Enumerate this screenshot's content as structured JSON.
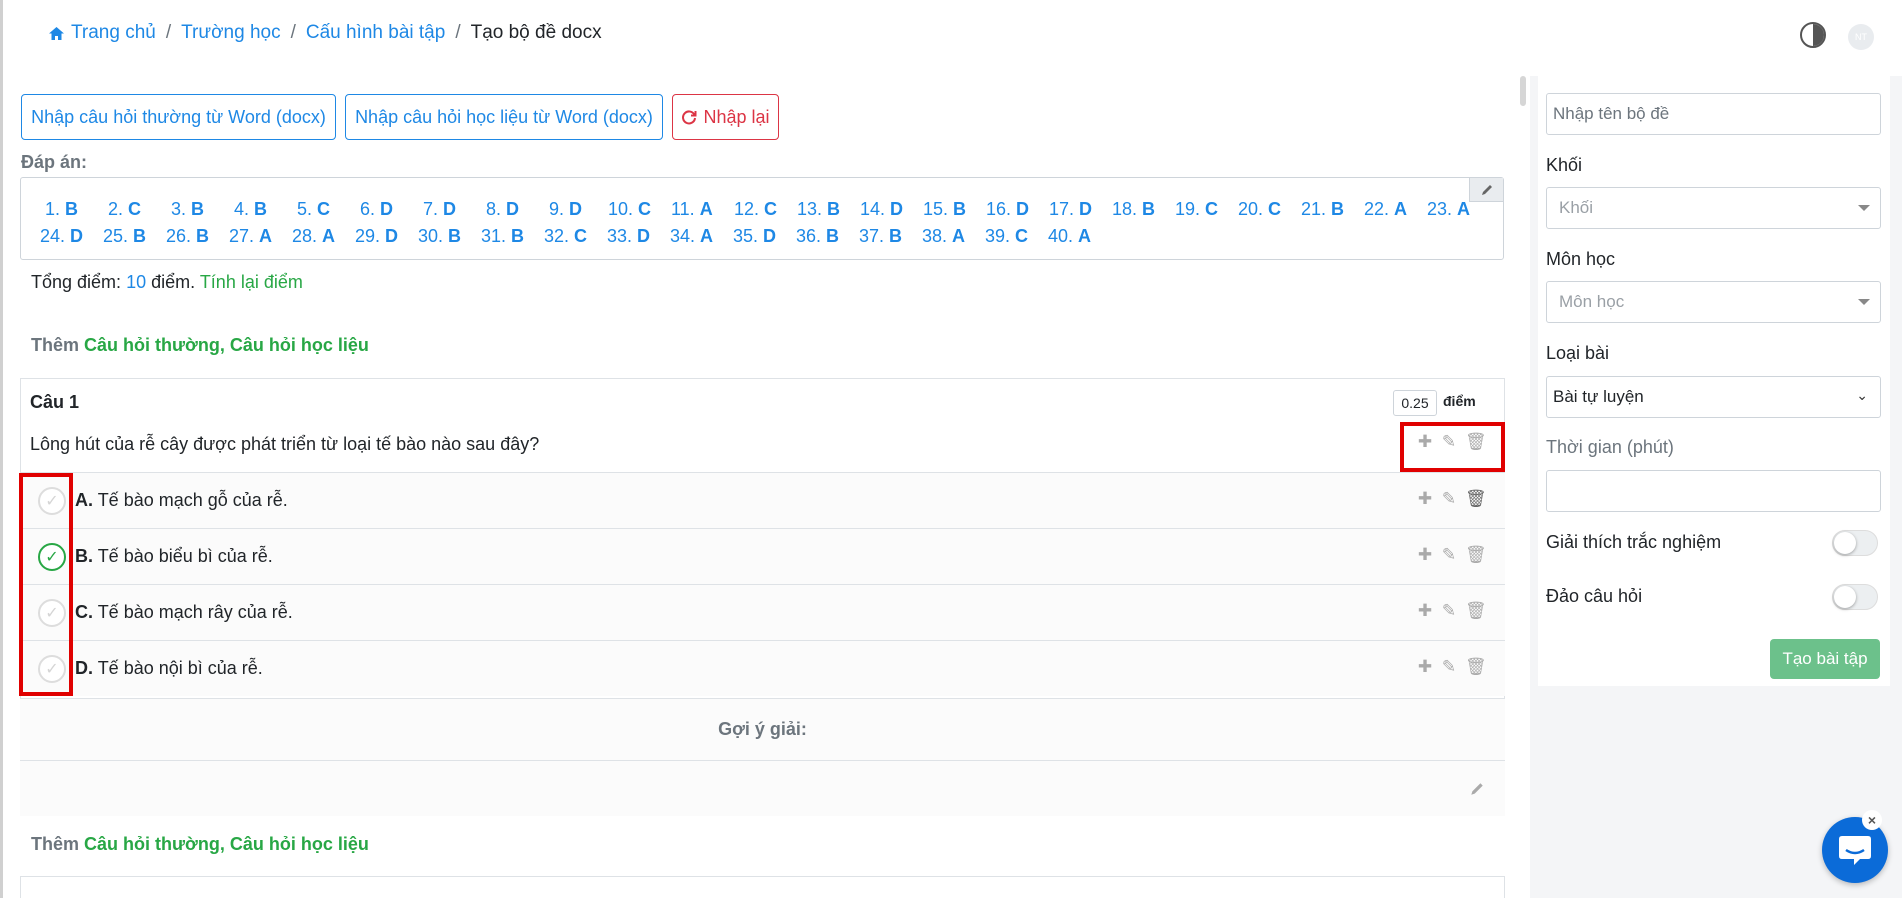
{
  "breadcrumb": {
    "home": "Trang chủ",
    "school": "Trường học",
    "config": "Cấu hình bài tập",
    "current": "Tạo bộ đề docx"
  },
  "header": {
    "avatar_initials": "NT"
  },
  "toolbar": {
    "import_normal": "Nhập câu hỏi thường từ Word (docx)",
    "import_material": "Nhập câu hỏi học liệu từ Word (docx)",
    "reset": "Nhập lại"
  },
  "answers": {
    "label": "Đáp án:",
    "items": [
      {
        "n": "1.",
        "a": "B"
      },
      {
        "n": "2.",
        "a": "C"
      },
      {
        "n": "3.",
        "a": "B"
      },
      {
        "n": "4.",
        "a": "B"
      },
      {
        "n": "5.",
        "a": "C"
      },
      {
        "n": "6.",
        "a": "D"
      },
      {
        "n": "7.",
        "a": "D"
      },
      {
        "n": "8.",
        "a": "D"
      },
      {
        "n": "9.",
        "a": "D"
      },
      {
        "n": "10.",
        "a": "C"
      },
      {
        "n": "11.",
        "a": "A"
      },
      {
        "n": "12.",
        "a": "C"
      },
      {
        "n": "13.",
        "a": "B"
      },
      {
        "n": "14.",
        "a": "D"
      },
      {
        "n": "15.",
        "a": "B"
      },
      {
        "n": "16.",
        "a": "D"
      },
      {
        "n": "17.",
        "a": "D"
      },
      {
        "n": "18.",
        "a": "B"
      },
      {
        "n": "19.",
        "a": "C"
      },
      {
        "n": "20.",
        "a": "C"
      },
      {
        "n": "21.",
        "a": "B"
      },
      {
        "n": "22.",
        "a": "A"
      },
      {
        "n": "23.",
        "a": "A"
      },
      {
        "n": "24.",
        "a": "D"
      },
      {
        "n": "25.",
        "a": "B"
      },
      {
        "n": "26.",
        "a": "B"
      },
      {
        "n": "27.",
        "a": "A"
      },
      {
        "n": "28.",
        "a": "A"
      },
      {
        "n": "29.",
        "a": "D"
      },
      {
        "n": "30.",
        "a": "B"
      },
      {
        "n": "31.",
        "a": "B"
      },
      {
        "n": "32.",
        "a": "C"
      },
      {
        "n": "33.",
        "a": "D"
      },
      {
        "n": "34.",
        "a": "A"
      },
      {
        "n": "35.",
        "a": "D"
      },
      {
        "n": "36.",
        "a": "B"
      },
      {
        "n": "37.",
        "a": "B"
      },
      {
        "n": "38.",
        "a": "A"
      },
      {
        "n": "39.",
        "a": "C"
      },
      {
        "n": "40.",
        "a": "A"
      }
    ]
  },
  "total": {
    "prefix": "Tổng điểm:",
    "value": "10",
    "suffix": "điểm.",
    "recalc": "Tính lại điểm"
  },
  "add_line": {
    "prefix": "Thêm",
    "links": "Câu hỏi thường, Câu hỏi học liệu"
  },
  "question": {
    "title": "Câu 1",
    "score": "0.25",
    "score_unit": "điểm",
    "text": "Lông hút của rễ cây được phát triển từ loại tế bào nào sau đây?",
    "options": [
      {
        "letter": "A.",
        "text": "Tế bào mạch gỗ của rễ.",
        "correct": false
      },
      {
        "letter": "B.",
        "text": "Tế bào biểu bì của rễ.",
        "correct": true
      },
      {
        "letter": "C.",
        "text": "Tế bào mạch rây của rễ.",
        "correct": false
      },
      {
        "letter": "D.",
        "text": "Tế bào nội bì của rễ.",
        "correct": false
      }
    ],
    "hint_label": "Gợi ý giải:"
  },
  "sidebar": {
    "name_placeholder": "Nhập tên bộ đề",
    "grade_label": "Khối",
    "grade_placeholder": "Khối",
    "subject_label": "Môn học",
    "subject_placeholder": "Môn học",
    "type_label": "Loại bài",
    "type_value": "Bài tự luyện",
    "time_label": "Thời gian (phút)",
    "explain_label": "Giải thích trắc nghiệm",
    "shuffle_label": "Đảo câu hỏi",
    "create_button": "Tạo bài tập"
  },
  "colors": {
    "primary": "#1e88e5",
    "success": "#28a745",
    "danger": "#dc3545",
    "highlight": "#e00000"
  }
}
